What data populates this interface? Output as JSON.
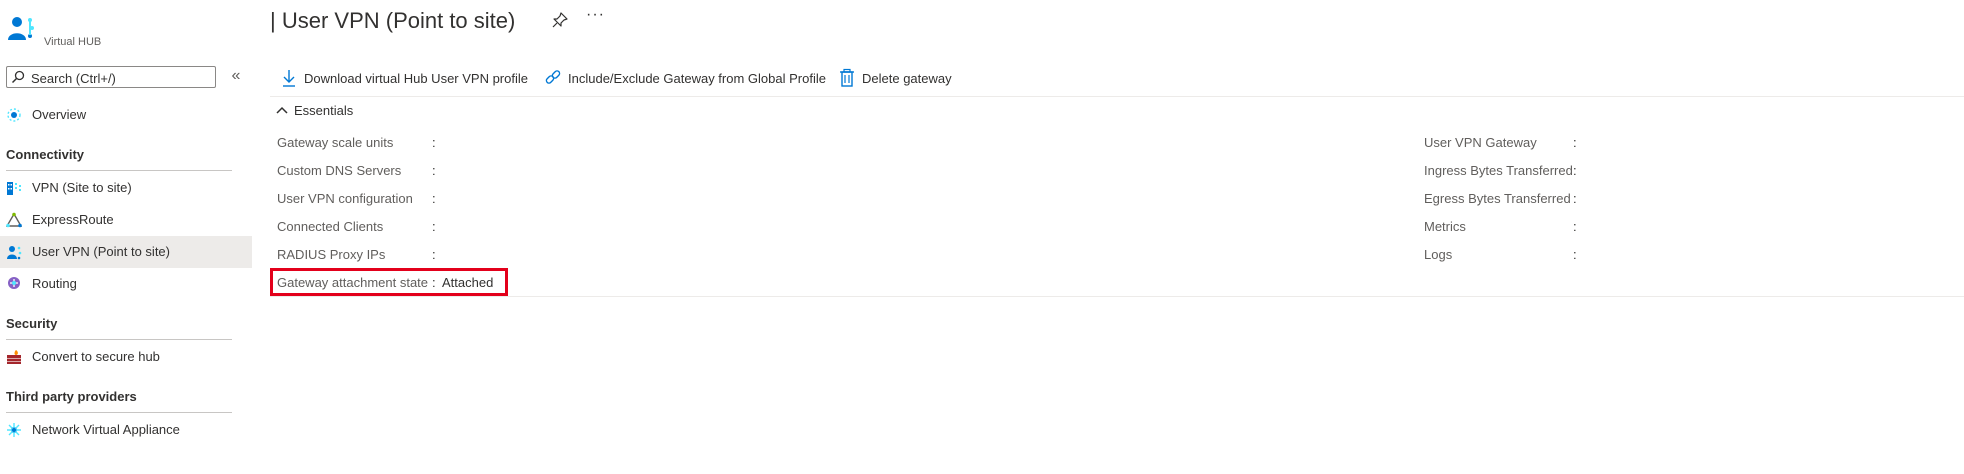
{
  "app": {
    "resource_type": "Virtual HUB",
    "page_title": "| User VPN (Point to site)",
    "more_glyph": "···"
  },
  "search": {
    "placeholder": "Search (Ctrl+/)",
    "collapse_glyph": "«"
  },
  "nav": {
    "overview": "Overview",
    "sections": [
      {
        "heading": "Connectivity",
        "items": [
          "VPN (Site to site)",
          "ExpressRoute",
          "User VPN (Point to site)",
          "Routing"
        ]
      },
      {
        "heading": "Security",
        "items": [
          "Convert to secure hub"
        ]
      },
      {
        "heading": "Third party providers",
        "items": [
          "Network Virtual Appliance"
        ]
      }
    ],
    "selected": "User VPN (Point to site)"
  },
  "commands": [
    {
      "label": "Download virtual Hub User VPN profile",
      "icon": "download-icon"
    },
    {
      "label": "Include/Exclude Gateway from Global Profile",
      "icon": "link-icon"
    },
    {
      "label": "Delete gateway",
      "icon": "trash-icon"
    }
  ],
  "essentials": {
    "toggle_label": "Essentials",
    "left": [
      {
        "label": "Gateway scale units",
        "value": ""
      },
      {
        "label": "Custom DNS Servers",
        "value": ""
      },
      {
        "label": "User VPN configuration",
        "value": ""
      },
      {
        "label": "Connected Clients",
        "value": ""
      },
      {
        "label": "RADIUS Proxy IPs",
        "value": ""
      },
      {
        "label": "Gateway attachment state",
        "value": "Attached"
      }
    ],
    "right": [
      {
        "label": "User VPN Gateway",
        "value": ""
      },
      {
        "label": "Ingress Bytes Transferred",
        "value": ""
      },
      {
        "label": "Egress Bytes Transferred",
        "value": ""
      },
      {
        "label": "Metrics",
        "value": ""
      },
      {
        "label": "Logs",
        "value": ""
      }
    ],
    "colon": ":"
  },
  "colors": {
    "accent": "#0078d4",
    "highlight_border": "#e3001b",
    "selected_bg": "#edebe9"
  }
}
